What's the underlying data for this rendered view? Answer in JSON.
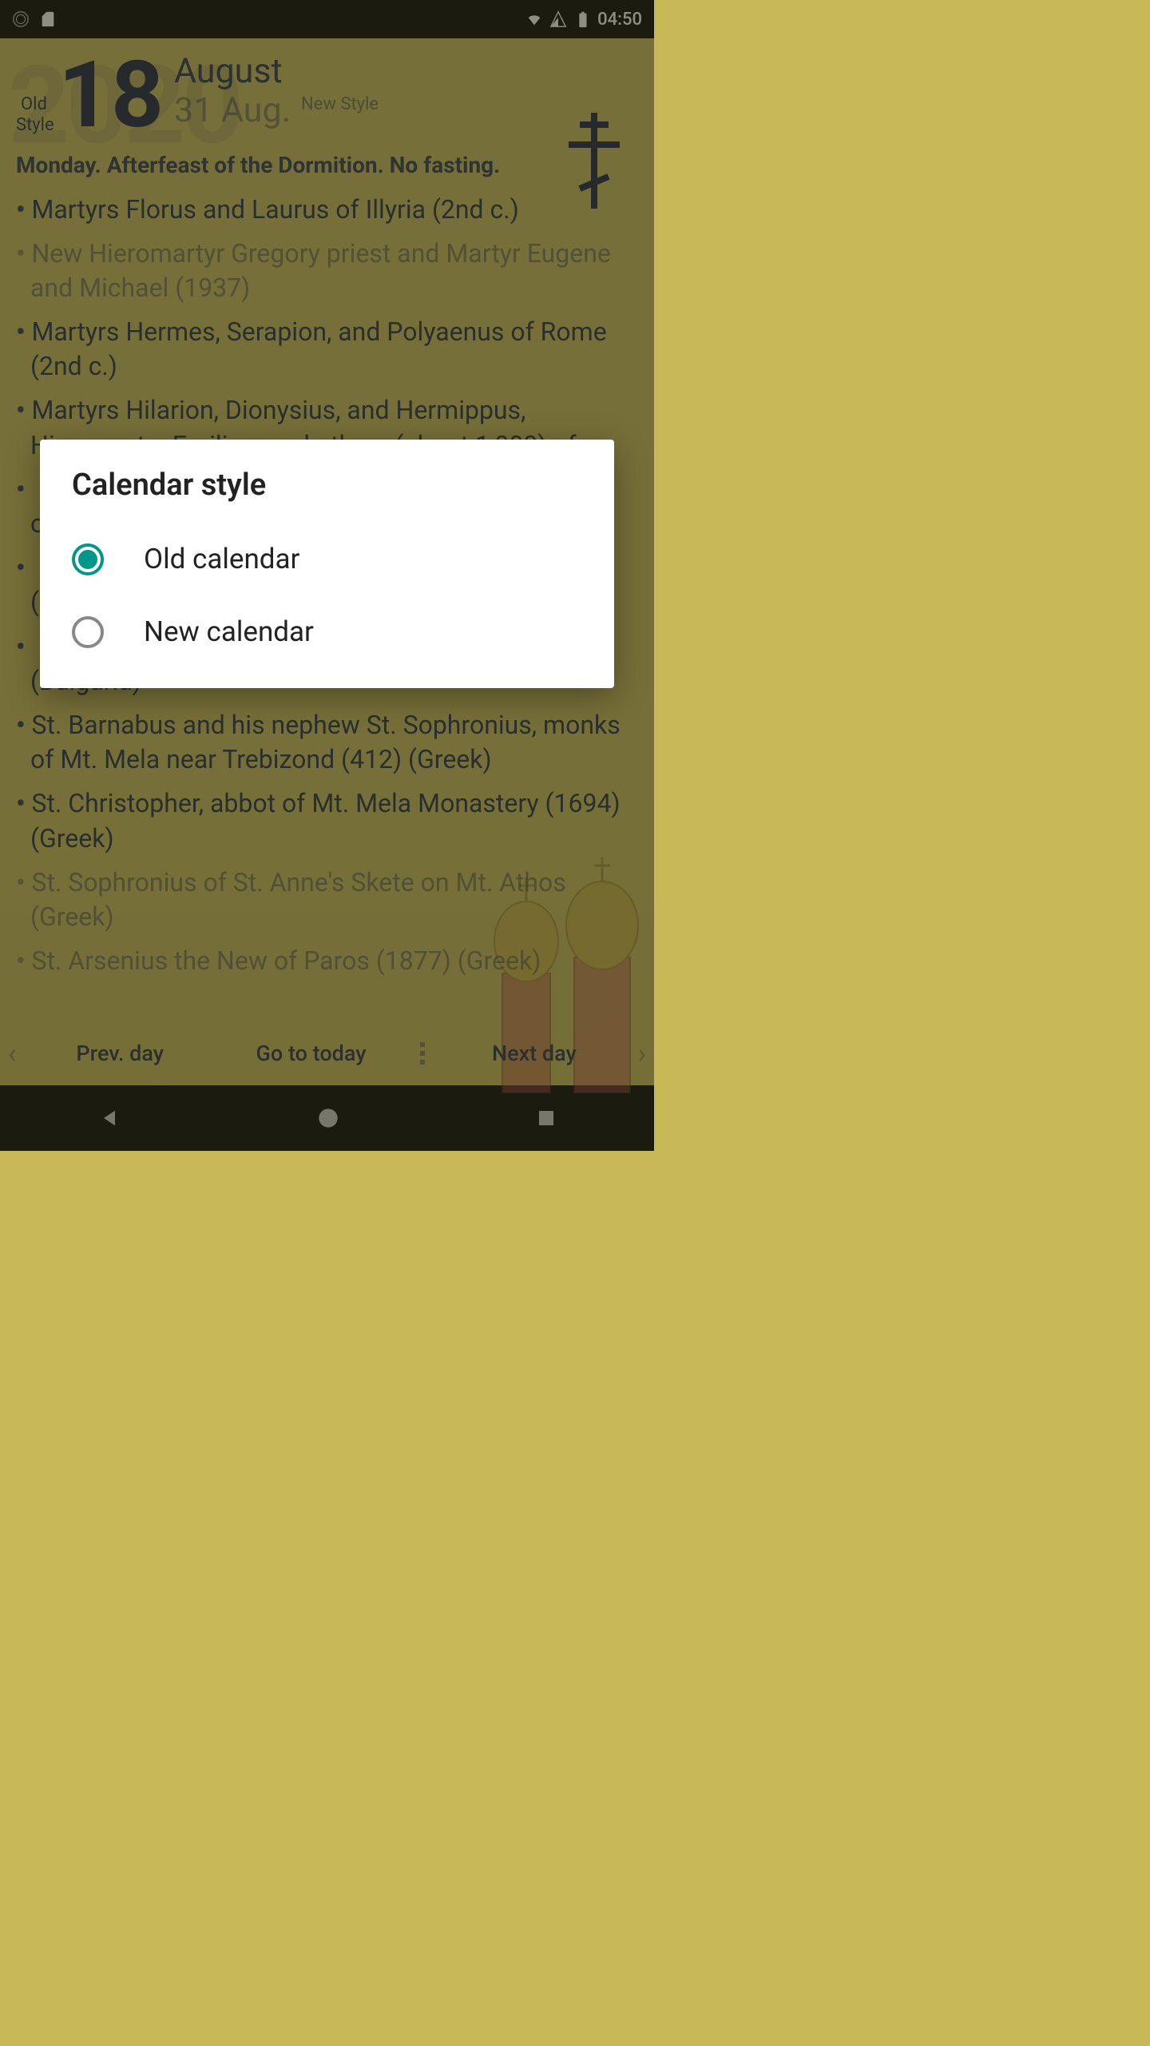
{
  "status": {
    "time": "04:50"
  },
  "date": {
    "old_style_label": "Old Style",
    "day_number": "18",
    "month_name": "August",
    "new_date": "31 Aug.",
    "new_style_label": "New Style",
    "bg_year": "2020"
  },
  "subtitle": "Monday. Afterfeast of the Dormition. No fasting.",
  "saints": [
    {
      "text": "Martyrs Florus and Laurus of Illyria (2nd c.)",
      "dim": false
    },
    {
      "text": "New Hieromartyr Gregory priest and Martyr Eugene and Michael (1937)",
      "dim": true
    },
    {
      "text": "Martyrs Hermes, Serapion, and Polyaenus of Rome (2nd c.)",
      "dim": false
    },
    {
      "text": "Martyrs Hilarion, Dionysius, and Hermippus, Hieromartyr Emilian, and others (about 1,000) of",
      "dim": false
    },
    {
      "text": "",
      "dim": false
    },
    {
      "text": "(8",
      "dim": false
    },
    {
      "text": "(Bulgaria)",
      "dim": false
    },
    {
      "text": "St. Barnabus and his nephew St. Sophronius, monks of Mt. Mela near Trebizond (412) (Greek)",
      "dim": false
    },
    {
      "text": "St. Christopher, abbot of Mt. Mela Monastery (1694) (Greek)",
      "dim": false
    },
    {
      "text": "St. Sophronius of St. Anne's Skete on Mt. Athos (Greek)",
      "dim": true
    },
    {
      "text": "St. Arsenius the New of Paros (1877) (Greek)",
      "dim": true
    }
  ],
  "nav": {
    "prev": "Prev. day",
    "today": "Go to today",
    "next": "Next day"
  },
  "dialog": {
    "title": "Calendar style",
    "option1": "Old calendar",
    "option2": "New calendar"
  }
}
